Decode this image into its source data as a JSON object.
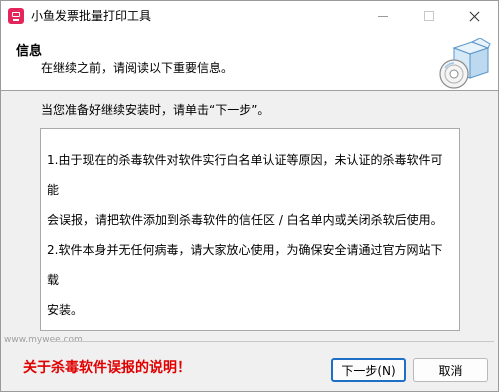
{
  "window": {
    "title": "小鱼发票批量打印工具"
  },
  "header": {
    "title": "信息",
    "subtitle": "在继续之前，请阅读以下重要信息。",
    "image_icon": "installer-box-cd-icon"
  },
  "intro": "当您准备好继续安装时，请单击“下一步”。",
  "info": {
    "line1": "1.由于现在的杀毒软件对软件实行白名单认证等原因，未认证的杀毒软件可能",
    "line2": "会误报，请把软件添加到杀毒软件的信任区 / 白名单内或关闭杀软后使用。",
    "line3": "2.软件本身并无任何病毒，请大家放心使用，为确保安全请通过官方网站下载",
    "line4": "安装。"
  },
  "watermark": "www.mywee.com",
  "notice_link": "关于杀毒软件误报的说明！",
  "buttons": {
    "next": "下一步(N)",
    "cancel": "取消"
  },
  "colors": {
    "notice": "#e00000",
    "default_button_border": "#1f6fc5",
    "app_icon": "#e4275a"
  }
}
